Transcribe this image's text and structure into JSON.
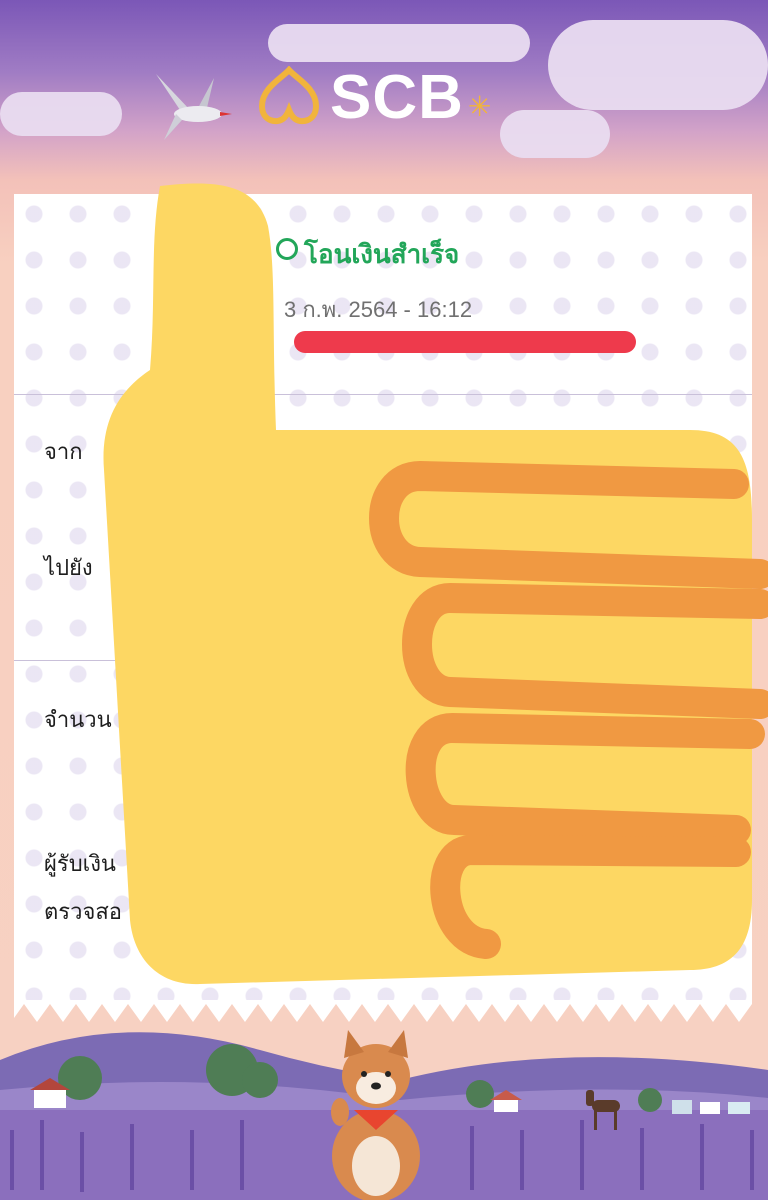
{
  "app": {
    "brand": "SCB",
    "accent_color": "#22a659",
    "brand_color": "#f1b43c"
  },
  "receipt": {
    "status": "โอนเงินสำเร็จ",
    "datetime": "3 ก.พ. 2564 - 16:12",
    "from_label": "จาก",
    "to_label": "ไปยัง",
    "amount_label": "จำนวน",
    "note_line1": "ผู้รับเงิน",
    "note_line2": "ตรวจสอ"
  },
  "icons": [
    "check-circle-icon",
    "scb-logo-icon",
    "thumbs-up-sticker-icon"
  ]
}
